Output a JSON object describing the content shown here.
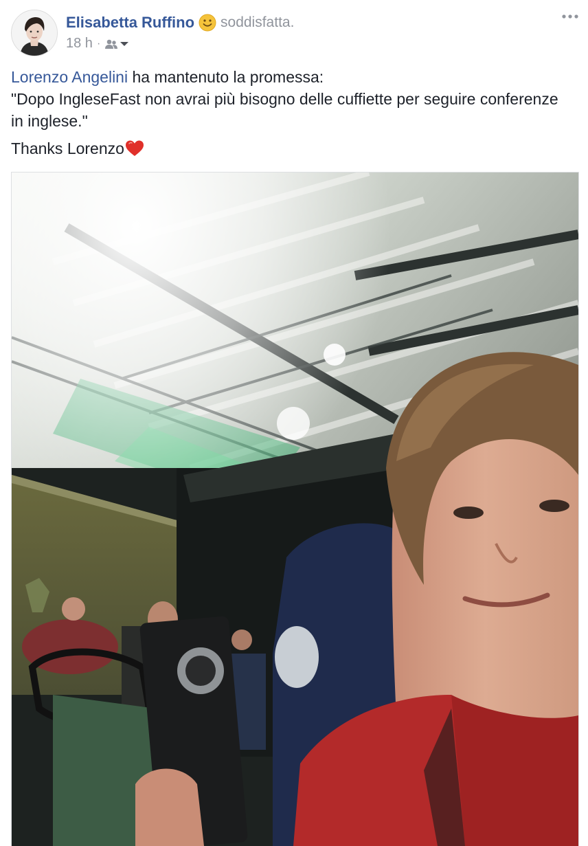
{
  "post": {
    "author": "Elisabetta Ruffino",
    "feeling": "soddisfatta.",
    "timestamp": "18 h",
    "separator": "·",
    "audience_icon": "friends-icon",
    "more_icon": "more-options-icon"
  },
  "text": {
    "mention": "Lorenzo Angelini",
    "line1_rest": " ha mantenuto la promessa:",
    "quote": "\"Dopo IngleseFast non avrai più bisogno delle cuffiette per seguire conferenze in inglese.\"",
    "thanks": "Thanks Lorenzo",
    "thanks_icon": "heart-icon"
  },
  "colors": {
    "link": "#365899",
    "secondary_text": "#90949c",
    "body_text": "#1d2129",
    "heart": "#e0302a",
    "smiley": "#f5c33b"
  }
}
